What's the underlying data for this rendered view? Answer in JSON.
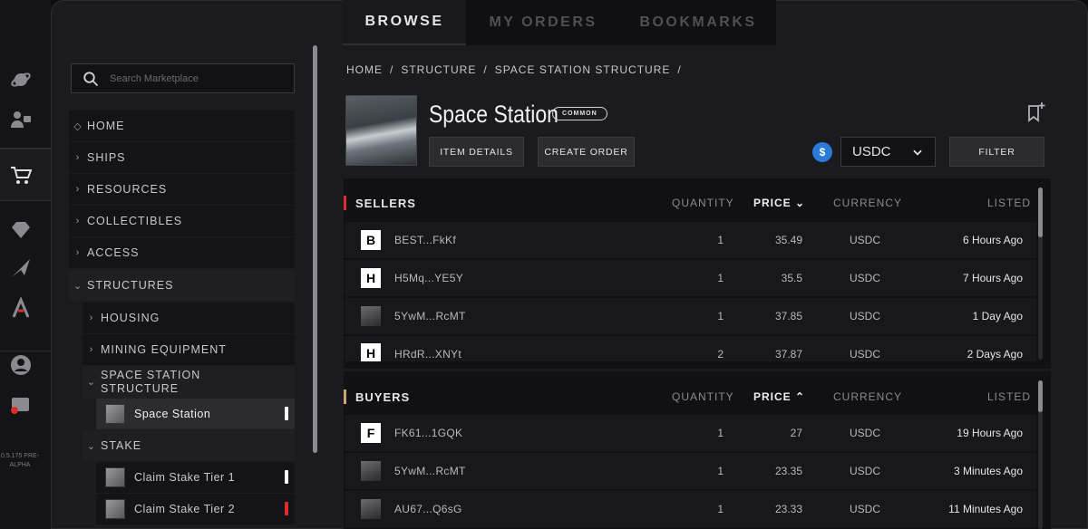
{
  "rail": {
    "icons": [
      "planet-icon",
      "profile-badge-icon",
      "cart-icon",
      "diamond-icon",
      "ship-icon",
      "atlas-icon",
      "account-icon",
      "wallet-icon"
    ],
    "version": "0.5.175 PRE-ALPHA"
  },
  "tabs": [
    {
      "label": "BROWSE",
      "active": true
    },
    {
      "label": "MY ORDERS",
      "active": false
    },
    {
      "label": "BOOKMARKS",
      "active": false
    }
  ],
  "sidebar": {
    "search_placeholder": "Search Marketplace",
    "items": [
      {
        "label": "HOME",
        "chev": "◇"
      },
      {
        "label": "SHIPS",
        "chev": "›"
      },
      {
        "label": "RESOURCES",
        "chev": "›"
      },
      {
        "label": "COLLECTIBLES",
        "chev": "›"
      },
      {
        "label": "ACCESS",
        "chev": "›"
      },
      {
        "label": "STRUCTURES",
        "chev": "⌄"
      },
      {
        "label": "HOUSING",
        "chev": "›"
      },
      {
        "label": "MINING EQUIPMENT",
        "chev": "›"
      },
      {
        "label": "SPACE STATION STRUCTURE",
        "chev": "⌄"
      },
      {
        "label": "Space Station"
      },
      {
        "label": "STAKE",
        "chev": "⌄"
      },
      {
        "label": "Claim Stake Tier 1"
      },
      {
        "label": "Claim Stake Tier 2"
      }
    ]
  },
  "breadcrumb": [
    "HOME",
    "/",
    "STRUCTURE",
    "/",
    "SPACE STATION STRUCTURE",
    "/"
  ],
  "item": {
    "title": "Space Station",
    "rarity": "COMMON",
    "details_label": "ITEM DETAILS",
    "create_order_label": "CREATE ORDER",
    "currency": "USDC",
    "filter_label": "FILTER"
  },
  "columns": {
    "quantity": "QUANTITY",
    "price": "PRICE",
    "currency": "CURRENCY",
    "listed": "LISTED"
  },
  "sellers": {
    "title": "SELLERS",
    "accent": "#d9302b",
    "sort_arrow": "⌄",
    "rows": [
      {
        "avatar": "B",
        "name": "BEST...FkKf",
        "qty": "1",
        "price": "35.49",
        "cur": "USDC",
        "listed": "6 Hours Ago"
      },
      {
        "avatar": "H",
        "name": "H5Mq...YE5Y",
        "qty": "1",
        "price": "35.5",
        "cur": "USDC",
        "listed": "7 Hours Ago"
      },
      {
        "avatar": "",
        "name": "5YwM...RcMT",
        "qty": "1",
        "price": "37.85",
        "cur": "USDC",
        "listed": "1 Day Ago"
      },
      {
        "avatar": "H",
        "name": "HRdR...XNYt",
        "qty": "2",
        "price": "37.87",
        "cur": "USDC",
        "listed": "2 Days Ago"
      }
    ]
  },
  "buyers": {
    "title": "BUYERS",
    "accent": "#c9a77a",
    "sort_arrow": "⌃",
    "rows": [
      {
        "avatar": "F",
        "name": "FK61...1GQK",
        "qty": "1",
        "price": "27",
        "cur": "USDC",
        "listed": "19 Hours Ago"
      },
      {
        "avatar": "",
        "name": "5YwM...RcMT",
        "qty": "1",
        "price": "23.35",
        "cur": "USDC",
        "listed": "3 Minutes Ago"
      },
      {
        "avatar": "",
        "name": "AU67...Q6sG",
        "qty": "1",
        "price": "23.33",
        "cur": "USDC",
        "listed": "11 Minutes Ago"
      }
    ]
  }
}
